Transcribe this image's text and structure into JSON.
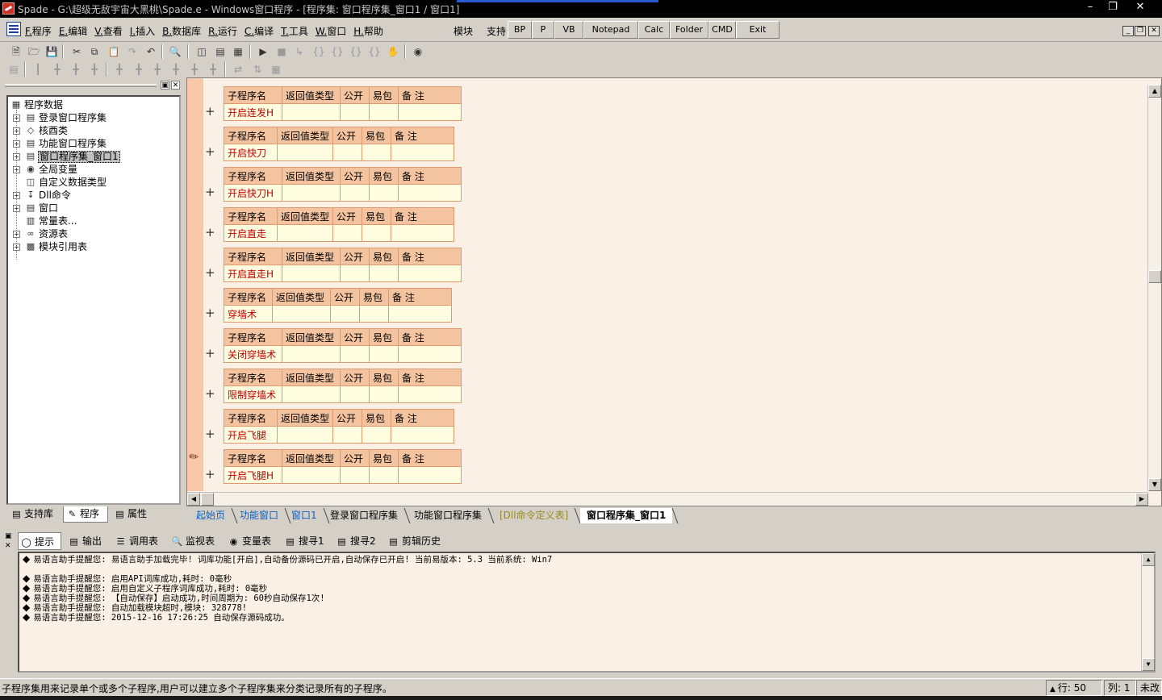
{
  "window": {
    "title": "Spade - G:\\超级无敌宇宙大黑桃\\Spade.e - Windows窗口程序 - [程序集: 窗口程序集_窗口1 / 窗口1]",
    "controls": [
      "minimize",
      "restore",
      "close"
    ]
  },
  "menu": {
    "items": [
      "F.程序",
      "E.编辑",
      "V.查看",
      "I.插入",
      "B.数据库",
      "R.运行",
      "C.编译",
      "T.工具",
      "W.窗口",
      "H.帮助"
    ],
    "module_label": "模块",
    "support_label": "支持",
    "quick_buttons": [
      "BP",
      "P",
      "VB",
      "Notepad",
      "Calc",
      "Folder",
      "CMD",
      "Exit"
    ]
  },
  "toolbar1": {
    "icons": [
      "new-file-icon",
      "open-folder-icon",
      "save-icon",
      "cut-icon",
      "copy-icon",
      "paste-icon",
      "redo-icon",
      "undo-icon",
      "find-icon",
      "layout-1-icon",
      "layout-2-icon",
      "layout-3-icon",
      "run-icon",
      "stop-icon",
      "step-into-icon",
      "step-icon",
      "step-over-icon",
      "step-out-icon",
      "run-to-cursor-icon",
      "breakpoint-icon",
      "binoculars-icon"
    ]
  },
  "left_panel": {
    "tree": [
      {
        "label": "程序数据",
        "icon": "program-data-icon",
        "level": 0,
        "expand": false
      },
      {
        "label": "登录窗口程序集",
        "icon": "module-icon",
        "level": 1,
        "expand": true
      },
      {
        "label": "核酉类",
        "icon": "class-icon",
        "level": 1,
        "expand": true
      },
      {
        "label": "功能窗口程序集",
        "icon": "module-icon",
        "level": 1,
        "expand": true
      },
      {
        "label": "窗口程序集_窗口1",
        "icon": "module-icon",
        "level": 1,
        "expand": true,
        "selected": true
      },
      {
        "label": "全局变量",
        "icon": "global-var-icon",
        "level": 1,
        "expand": true
      },
      {
        "label": "自定义数据类型",
        "icon": "datatype-icon",
        "level": 1,
        "expand": false
      },
      {
        "label": "Dll命令",
        "icon": "dll-icon",
        "level": 1,
        "expand": true
      },
      {
        "label": "窗口",
        "icon": "window-icon",
        "level": 1,
        "expand": true
      },
      {
        "label": "常量表...",
        "icon": "constant-icon",
        "level": 1,
        "expand": false
      },
      {
        "label": "资源表",
        "icon": "resource-icon",
        "level": 1,
        "expand": true
      },
      {
        "label": "模块引用表",
        "icon": "module-ref-icon",
        "level": 1,
        "expand": true
      }
    ],
    "tabs": [
      "支持库",
      "程序",
      "属性"
    ],
    "active_tab": 1
  },
  "editor": {
    "header": [
      "子程序名",
      "返回值类型",
      "公开",
      "易包",
      "备 注"
    ],
    "subroutines": [
      "开启连发H",
      "开启快刀",
      "开启快刀H",
      "开启直走",
      "开启直走H",
      "穿墙术",
      "关闭穿墙术",
      "限制穿墙术",
      "开启飞腿",
      "开启飞腿H"
    ],
    "tabs": [
      "起始页",
      "功能窗口",
      "窗口1",
      "登录窗口程序集",
      "功能窗口程序集",
      "[Dll命令定义表]",
      "窗口程序集_窗口1"
    ],
    "active_tab": 6,
    "accent": "#f4c4a0",
    "row_bg": "#fffde0",
    "name_color": "#c00000"
  },
  "output": {
    "tabs": [
      "提示",
      "输出",
      "调用表",
      "监视表",
      "变量表",
      "搜寻1",
      "搜寻2",
      "剪辑历史"
    ],
    "active_tab": 0,
    "lines": [
      "易语言助手提醒您:  易语言助手加载完毕!  词库功能[开启],自动备份源码已开启,自动保存已开启!  当前易版本: 5.3  当前系统: Win7",
      "",
      "易语言助手提醒您: 启用API词库成功,耗时: 0毫秒",
      "易语言助手提醒您: 启用自定义子程序词库成功,耗时: 0毫秒",
      "易语言助手提醒您: 【自动保存】启动成功,时间周期为: 60秒自动保存1次!",
      "易语言助手提醒您: 自动加载模块超时,模块: 328778!",
      "易语言助手提醒您: 2015-12-16 17:26:25 自动保存源码成功。"
    ]
  },
  "status": {
    "message": "子程序集用来记录单个或多个子程序,用户可以建立多个子程序集来分类记录所有的子程序。",
    "row": "行: 50",
    "col": "列: 1",
    "state": "未改"
  }
}
